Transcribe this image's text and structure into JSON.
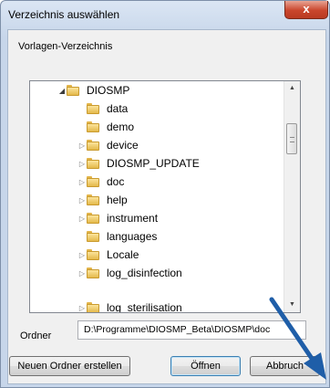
{
  "window": {
    "title": "Verzeichnis auswählen",
    "close_symbol": "x"
  },
  "dialog": {
    "heading": "Vorlagen-Verzeichnis"
  },
  "tree": {
    "root": {
      "label": "DIOSMP",
      "expanded": true
    },
    "items": [
      {
        "label": "data",
        "has_children": false
      },
      {
        "label": "demo",
        "has_children": false
      },
      {
        "label": "device",
        "has_children": true
      },
      {
        "label": "DIOSMP_UPDATE",
        "has_children": true
      },
      {
        "label": "doc",
        "has_children": true
      },
      {
        "label": "help",
        "has_children": true
      },
      {
        "label": "instrument",
        "has_children": true
      },
      {
        "label": "languages",
        "has_children": false
      },
      {
        "label": "Locale",
        "has_children": true
      },
      {
        "label": "log_disinfection",
        "has_children": true
      },
      {
        "label": "log_sterilisation",
        "has_children": true
      }
    ]
  },
  "folder_field": {
    "label": "Ordner",
    "value": "D:\\Programme\\DIOSMP_Beta\\DIOSMP\\doc"
  },
  "buttons": {
    "new_folder": "Neuen Ordner erstellen",
    "open": "Öffnen",
    "cancel": "Abbruch"
  },
  "icons": {
    "folder": "folder-icon",
    "expand_arrow": "chevron-right-icon",
    "collapse_arrow": "chevron-down-icon",
    "annotation": "blue-arrow-icon"
  },
  "colors": {
    "close_button": "#c9462c",
    "annotation_arrow": "#1f5ea8",
    "title_bar": "#dbe6f4"
  }
}
